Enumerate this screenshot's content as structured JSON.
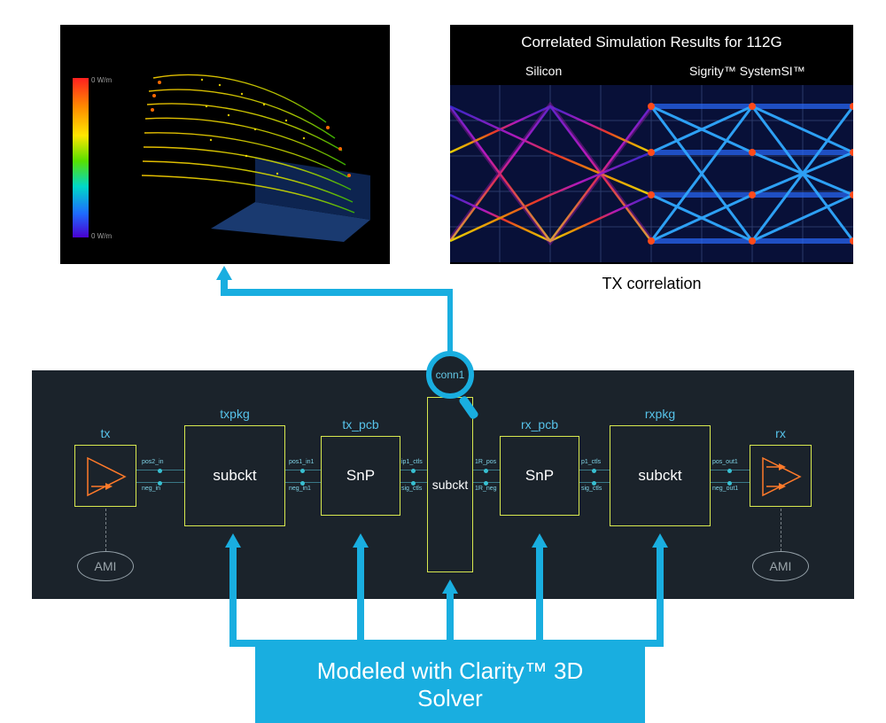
{
  "panel3d": {
    "colormap_top": "0 W/m",
    "colormap_bottom": "0 W/m"
  },
  "eye": {
    "title": "Correlated Simulation Results for 112G",
    "left_label": "Silicon",
    "right_label": "Sigrity™ SystemSI™",
    "caption": "TX correlation"
  },
  "topology": {
    "blocks": [
      {
        "id": "tx",
        "top_label": "tx",
        "center": "",
        "ports": [
          "pos2_in",
          "neg_in"
        ]
      },
      {
        "id": "txpkg",
        "top_label": "txpkg",
        "center": "subckt",
        "ports": [
          "pos1_in1",
          "neg_in1"
        ]
      },
      {
        "id": "tx_pcb",
        "top_label": "tx_pcb",
        "center": "SnP",
        "ports": [
          "ip1_ctls",
          "sig_ctls"
        ]
      },
      {
        "id": "conn1",
        "top_label": "conn1",
        "center": "subckt",
        "ports": [
          "1R_pos",
          "1R_neg"
        ]
      },
      {
        "id": "rx_pcb",
        "top_label": "rx_pcb",
        "center": "SnP",
        "ports": [
          "p1_ctls",
          "sig_ctls"
        ]
      },
      {
        "id": "rxpkg",
        "top_label": "rxpkg",
        "center": "subckt",
        "ports": [
          "pos_out1",
          "neg_out1"
        ]
      },
      {
        "id": "rx",
        "top_label": "rx",
        "center": "",
        "ports": []
      }
    ],
    "ami": "AMI"
  },
  "banner": "Modeled with Clarity™ 3D Solver",
  "colors": {
    "accent_blue": "#19aee0",
    "panel_dark": "#1b232b",
    "block_border": "#d8e84f",
    "label_cyan": "#57c3ea"
  }
}
